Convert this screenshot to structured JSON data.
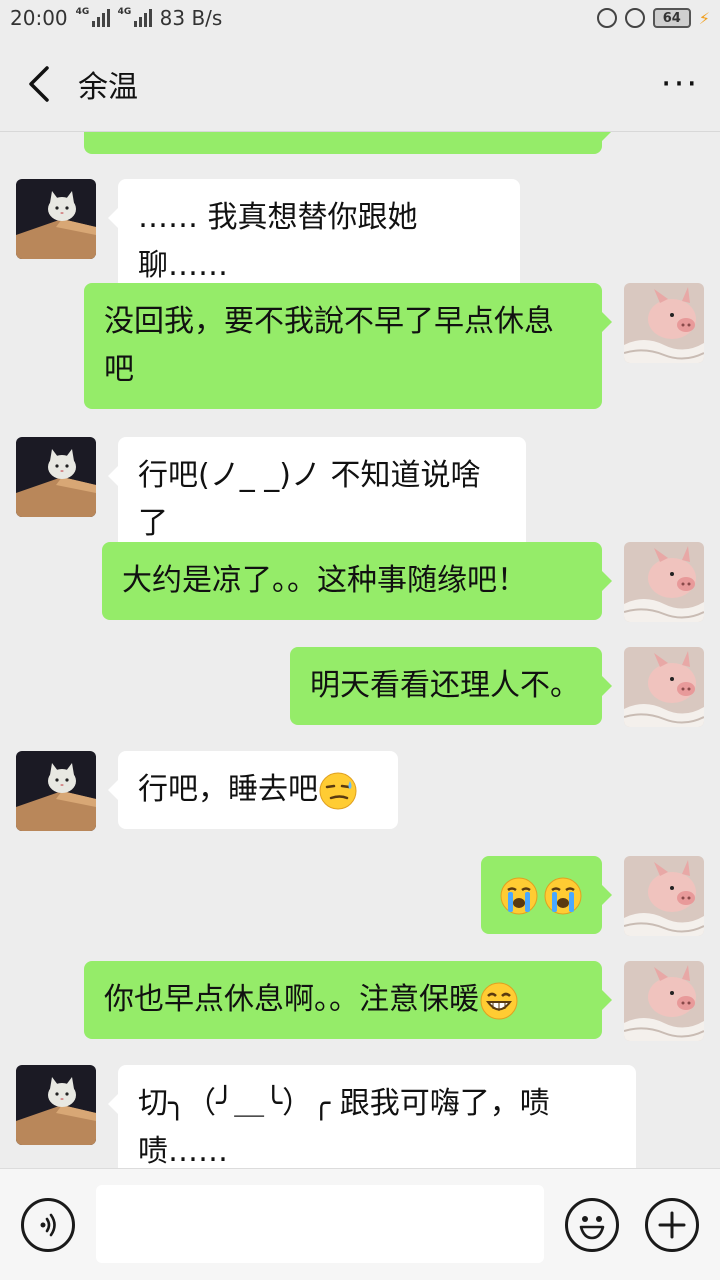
{
  "status_bar": {
    "time": "20:00",
    "network_1": "4G",
    "network_2": "4G",
    "speed": "83 B/s",
    "battery": "64",
    "icons": [
      "signal-icon",
      "lock-rotation-icon",
      "alarm-icon",
      "battery-icon",
      "charging-icon"
    ]
  },
  "header": {
    "title": "余温",
    "back_icon": "chevron-left-icon",
    "more_icon": "more-icon",
    "more_label": "···"
  },
  "messages": [
    {
      "side": "out",
      "text": ""
    },
    {
      "side": "in",
      "text": "…… 我真想替你跟她聊……"
    },
    {
      "side": "out",
      "text": "没回我，要不我說不早了早点休息吧"
    },
    {
      "side": "in",
      "text": "行吧(ノ_ _)ノ 不知道说啥了"
    },
    {
      "side": "out",
      "text": "大约是凉了。。这种事随缘吧！"
    },
    {
      "side": "out",
      "text": "明天看看还理人不。"
    },
    {
      "side": "in",
      "text": "行吧，睡去吧",
      "emoji": "smirk-emoji"
    },
    {
      "side": "out",
      "text": "",
      "emoji": "crying-emoji-x2"
    },
    {
      "side": "out",
      "text": "你也早点休息啊。。注意保暖",
      "emoji": "grin-emoji"
    },
    {
      "side": "in",
      "text": "切╮（╯＿╰）╭ 跟我可嗨了，啧啧……"
    }
  ],
  "input_bar": {
    "voice_icon": "voice-icon",
    "input_value": "",
    "emoji_icon": "emoji-icon",
    "plus_icon": "plus-icon"
  },
  "colors": {
    "background": "#ededed",
    "outgoing_bubble": "#95ec69",
    "incoming_bubble": "#ffffff"
  }
}
